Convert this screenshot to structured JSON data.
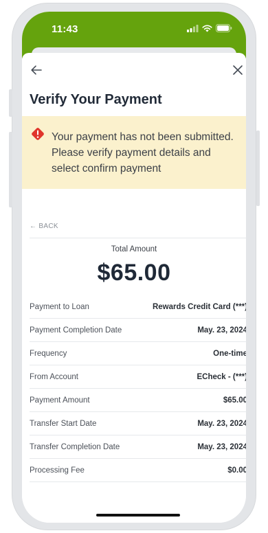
{
  "status_bar": {
    "time": "11:43",
    "icons": [
      "signal-icon",
      "wifi-icon",
      "battery-icon"
    ]
  },
  "nav": {
    "back_icon": "arrow-left-icon",
    "close_icon": "close-icon"
  },
  "page": {
    "title": "Verify Your Payment"
  },
  "alert": {
    "icon": "warning-diamond-icon",
    "message": "Your payment has not been submitted. Please verify payment details and select confirm payment"
  },
  "back_link": {
    "label": "← BACK"
  },
  "total": {
    "label": "Total Amount",
    "amount": "$65.00"
  },
  "details": [
    {
      "label": "Payment to Loan",
      "value": "Rewards Credit Card (***)"
    },
    {
      "label": "Payment Completion Date",
      "value": "May. 23, 2024"
    },
    {
      "label": "Frequency",
      "value": "One-time"
    },
    {
      "label": "From Account",
      "value": "ECheck - (***)"
    },
    {
      "label": "Payment Amount",
      "value": "$65.00"
    },
    {
      "label": "Transfer Start Date",
      "value": "May. 23, 2024"
    },
    {
      "label": "Transfer Completion Date",
      "value": "May. 23, 2024"
    },
    {
      "label": "Processing Fee",
      "value": "$0.00"
    }
  ],
  "colors": {
    "header_green": "#65a30d",
    "alert_background": "#fbf1cd",
    "alert_icon": "#e0352b",
    "title_text": "#222b38"
  }
}
